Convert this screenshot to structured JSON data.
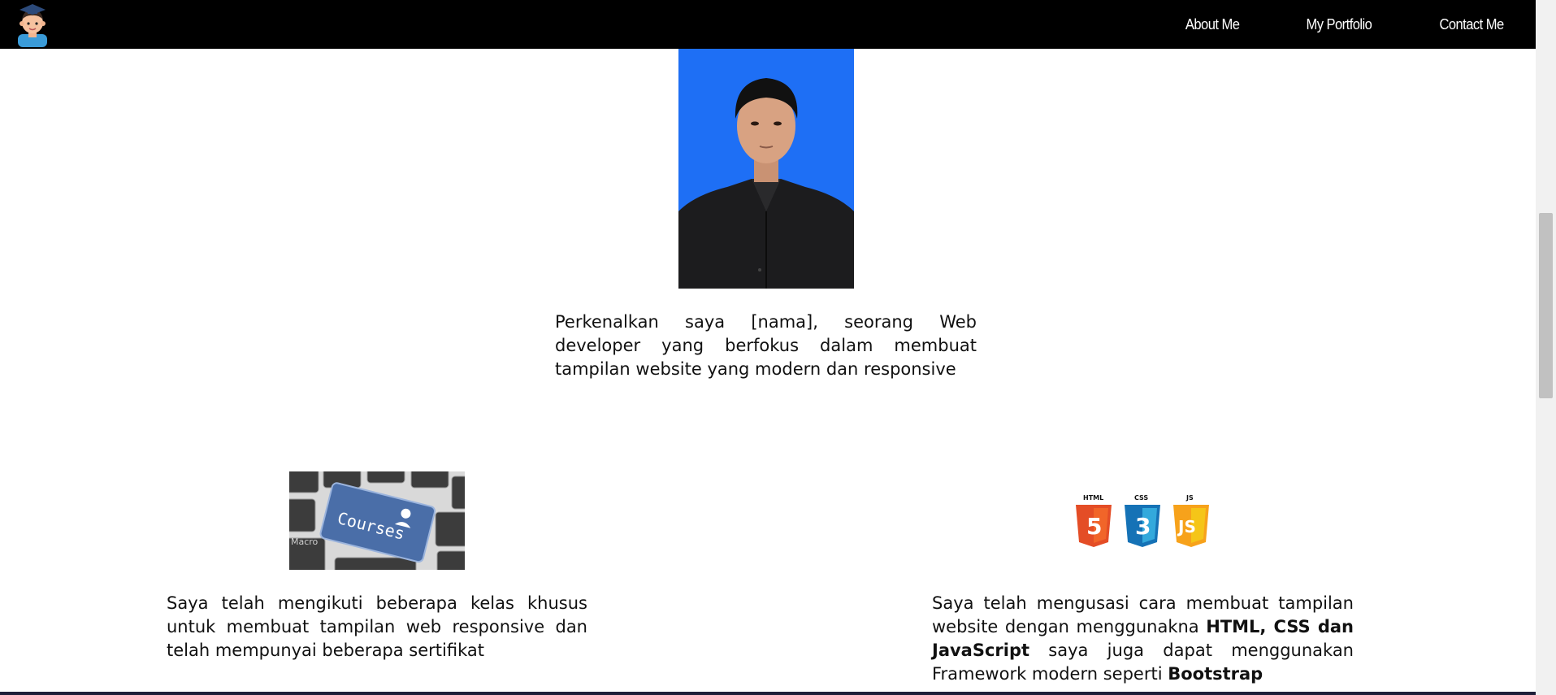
{
  "nav": {
    "links": [
      "About Me",
      "My Portfolio",
      "Contact Me"
    ]
  },
  "intro": {
    "text": "Perkenalkan saya [nama], seorang Web developer yang berfokus dalam membuat tampilan website yang modern dan responsive"
  },
  "courses": {
    "image_text": "Courses",
    "text": "Saya telah mengikuti beberapa kelas khusus untuk membuat tampilan web responsive dan telah mempunyai beberapa sertifikat"
  },
  "tech": {
    "icons": [
      {
        "label": "HTML",
        "number": "5",
        "color": "#e44d26"
      },
      {
        "label": "CSS",
        "number": "3",
        "color": "#1572b6"
      },
      {
        "label": "JS",
        "number": "JS",
        "color": "#f7a21b"
      }
    ],
    "text_part1": "Saya telah mengusasi cara membuat tampilan website dengan menggunakna ",
    "text_bold1": "HTML, CSS dan JavaScript",
    "text_part2": " saya juga dapat menggunakan Framework modern seperti ",
    "text_bold2": "Bootstrap"
  },
  "colors": {
    "navbar": "#000000",
    "photo_background": "#1e6ff5"
  }
}
